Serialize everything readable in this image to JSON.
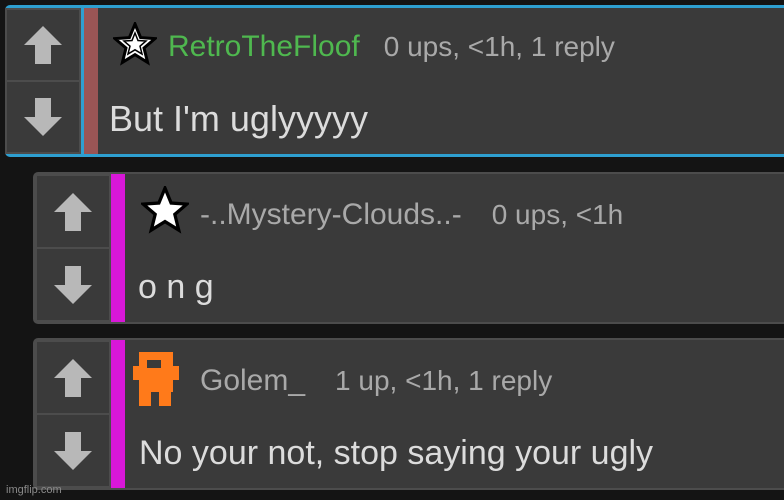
{
  "colors": {
    "background": "#141414",
    "panel": "#3a3a3a",
    "selected_border": "#2e9fd0",
    "first_bar": "#9a5555",
    "reply_bar": "#d817d8",
    "green_username": "#4fb84f",
    "gray_username": "#a9a9a9",
    "golem_avatar": "#ff7a1a"
  },
  "comments": [
    {
      "username": "RetroTheFloof",
      "meta": "0 ups, <1h, 1 reply",
      "body": "But I'm uglyyyyy",
      "badge_icon": "outlined-star-icon"
    },
    {
      "username": "-..Mystery-Clouds..-",
      "meta": "0 ups, <1h",
      "body": "o n g",
      "badge_icon": "white-star-icon"
    },
    {
      "username": "Golem_",
      "meta": "1 up, <1h, 1 reply",
      "body": "No your not, stop saying your ugly",
      "badge_icon": "pixel-avatar-icon"
    }
  ],
  "icons": {
    "upvote": "up-arrow-icon",
    "downvote": "down-arrow-icon"
  },
  "watermark": "imgflip.com"
}
